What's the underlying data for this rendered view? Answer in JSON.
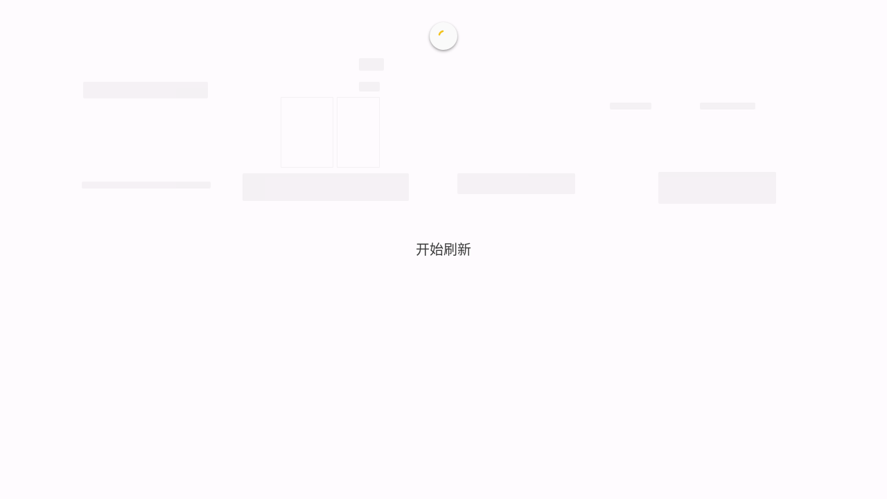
{
  "refresh": {
    "status_text": "开始刷新",
    "indicator_icon": "loading-spinner-icon",
    "indicator_color": "#f2c21b"
  },
  "colors": {
    "background": "#fefbfe",
    "text": "#3b3b3b",
    "indicator_bg": "#fafafa"
  }
}
